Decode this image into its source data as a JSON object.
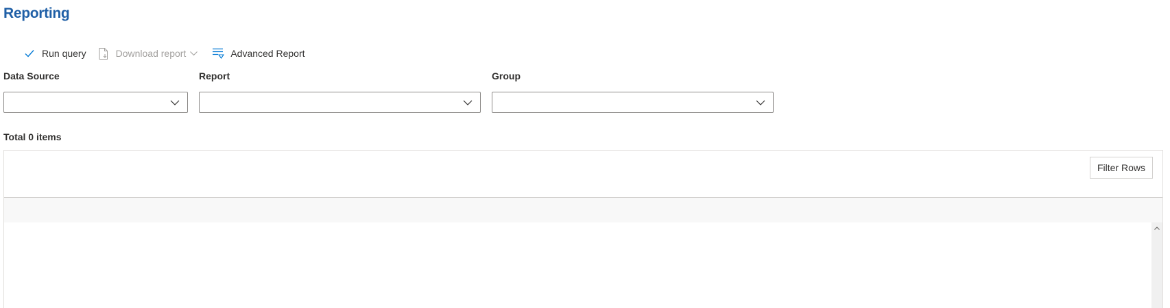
{
  "page": {
    "title": "Reporting"
  },
  "toolbar": {
    "run_query": "Run query",
    "download_report": "Download report",
    "advanced_report": "Advanced Report"
  },
  "filters": {
    "data_source": {
      "label": "Data Source",
      "value": ""
    },
    "report": {
      "label": "Report",
      "value": ""
    },
    "group": {
      "label": "Group",
      "value": ""
    }
  },
  "results": {
    "total_label": "Total 0 items"
  },
  "grid": {
    "filter_rows": "Filter Rows"
  },
  "colors": {
    "accent": "#1f5fa6",
    "icon_blue": "#0078d4",
    "disabled": "#a19f9d"
  },
  "icons": {
    "run_query": "checkmark-icon",
    "download_report": "document-download-icon",
    "advanced_report": "filter-lines-icon",
    "dropdown": "chevron-down-icon"
  }
}
